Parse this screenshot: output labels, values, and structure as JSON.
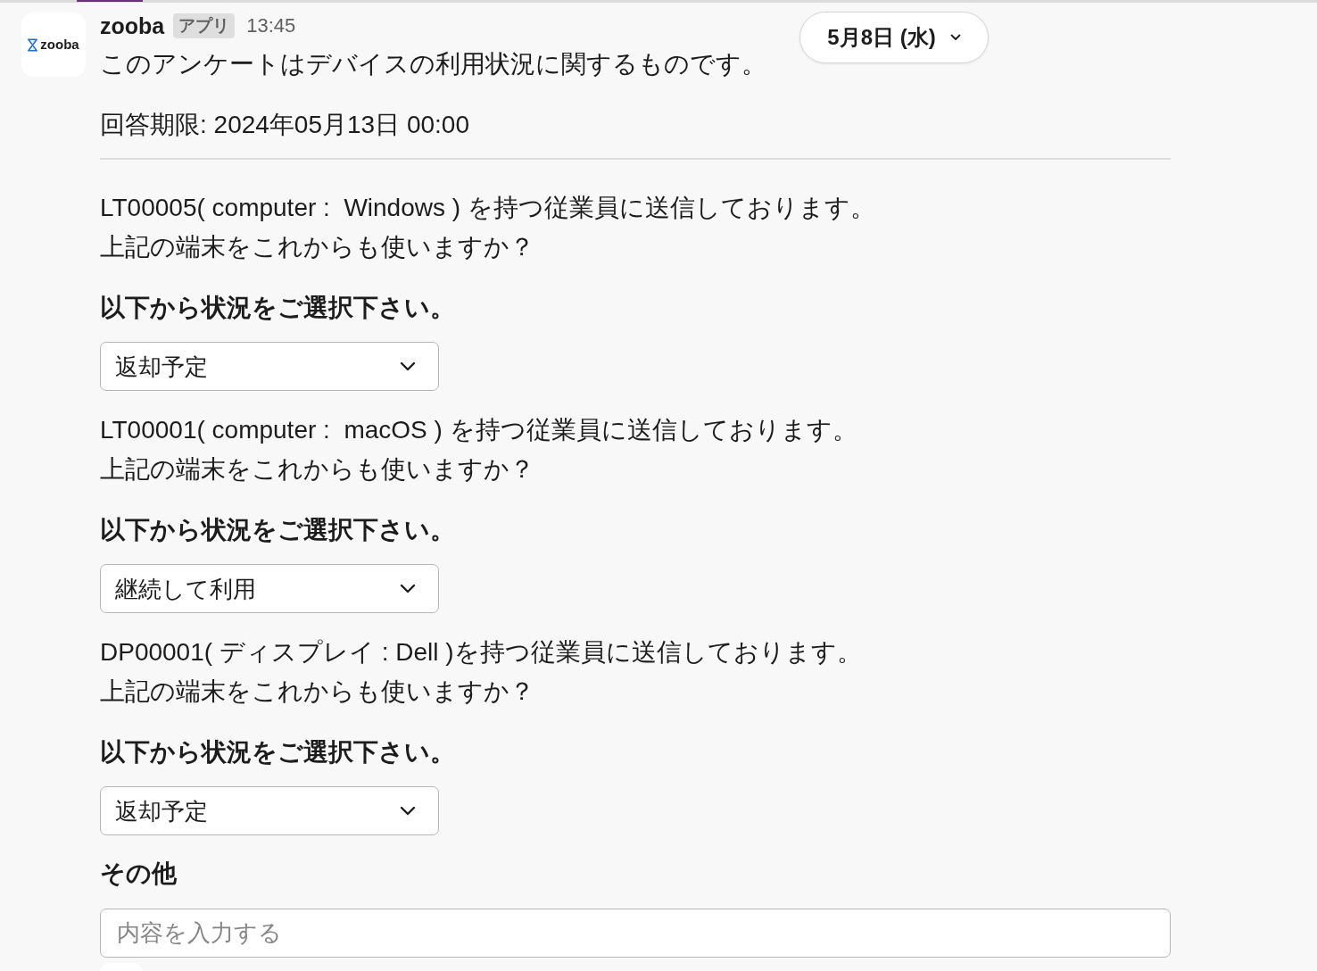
{
  "message": {
    "avatar_text": "zooba",
    "sender": "zooba",
    "badge": "アプリ",
    "time": "13:45",
    "date_pill": "5月8日 (水)",
    "intro": "このアンケートはデバイスの利用状況に関するものです。",
    "deadline": "回答期限: 2024年05月13日 00:00",
    "questions": [
      {
        "lines": [
          "LT00005( computer :  Windows ) を持つ従業員に送信しております。",
          "上記の端末をこれからも使いますか？"
        ],
        "prompt": "以下から状況をご選択下さい。",
        "answer": "返却予定"
      },
      {
        "lines": [
          "LT00001( computer :  macOS ) を持つ従業員に送信しております。",
          "上記の端末をこれからも使いますか？"
        ],
        "prompt": "以下から状況をご選択下さい。",
        "answer": "継続して利用"
      },
      {
        "lines": [
          "DP00001( ディスプレイ : Dell )を持つ従業員に送信しております。",
          "上記の端末をこれからも使いますか？"
        ],
        "prompt": "以下から状況をご選択下さい。",
        "answer": "返却予定"
      }
    ],
    "other": {
      "label": "その他",
      "placeholder": "内容を入力する"
    }
  }
}
